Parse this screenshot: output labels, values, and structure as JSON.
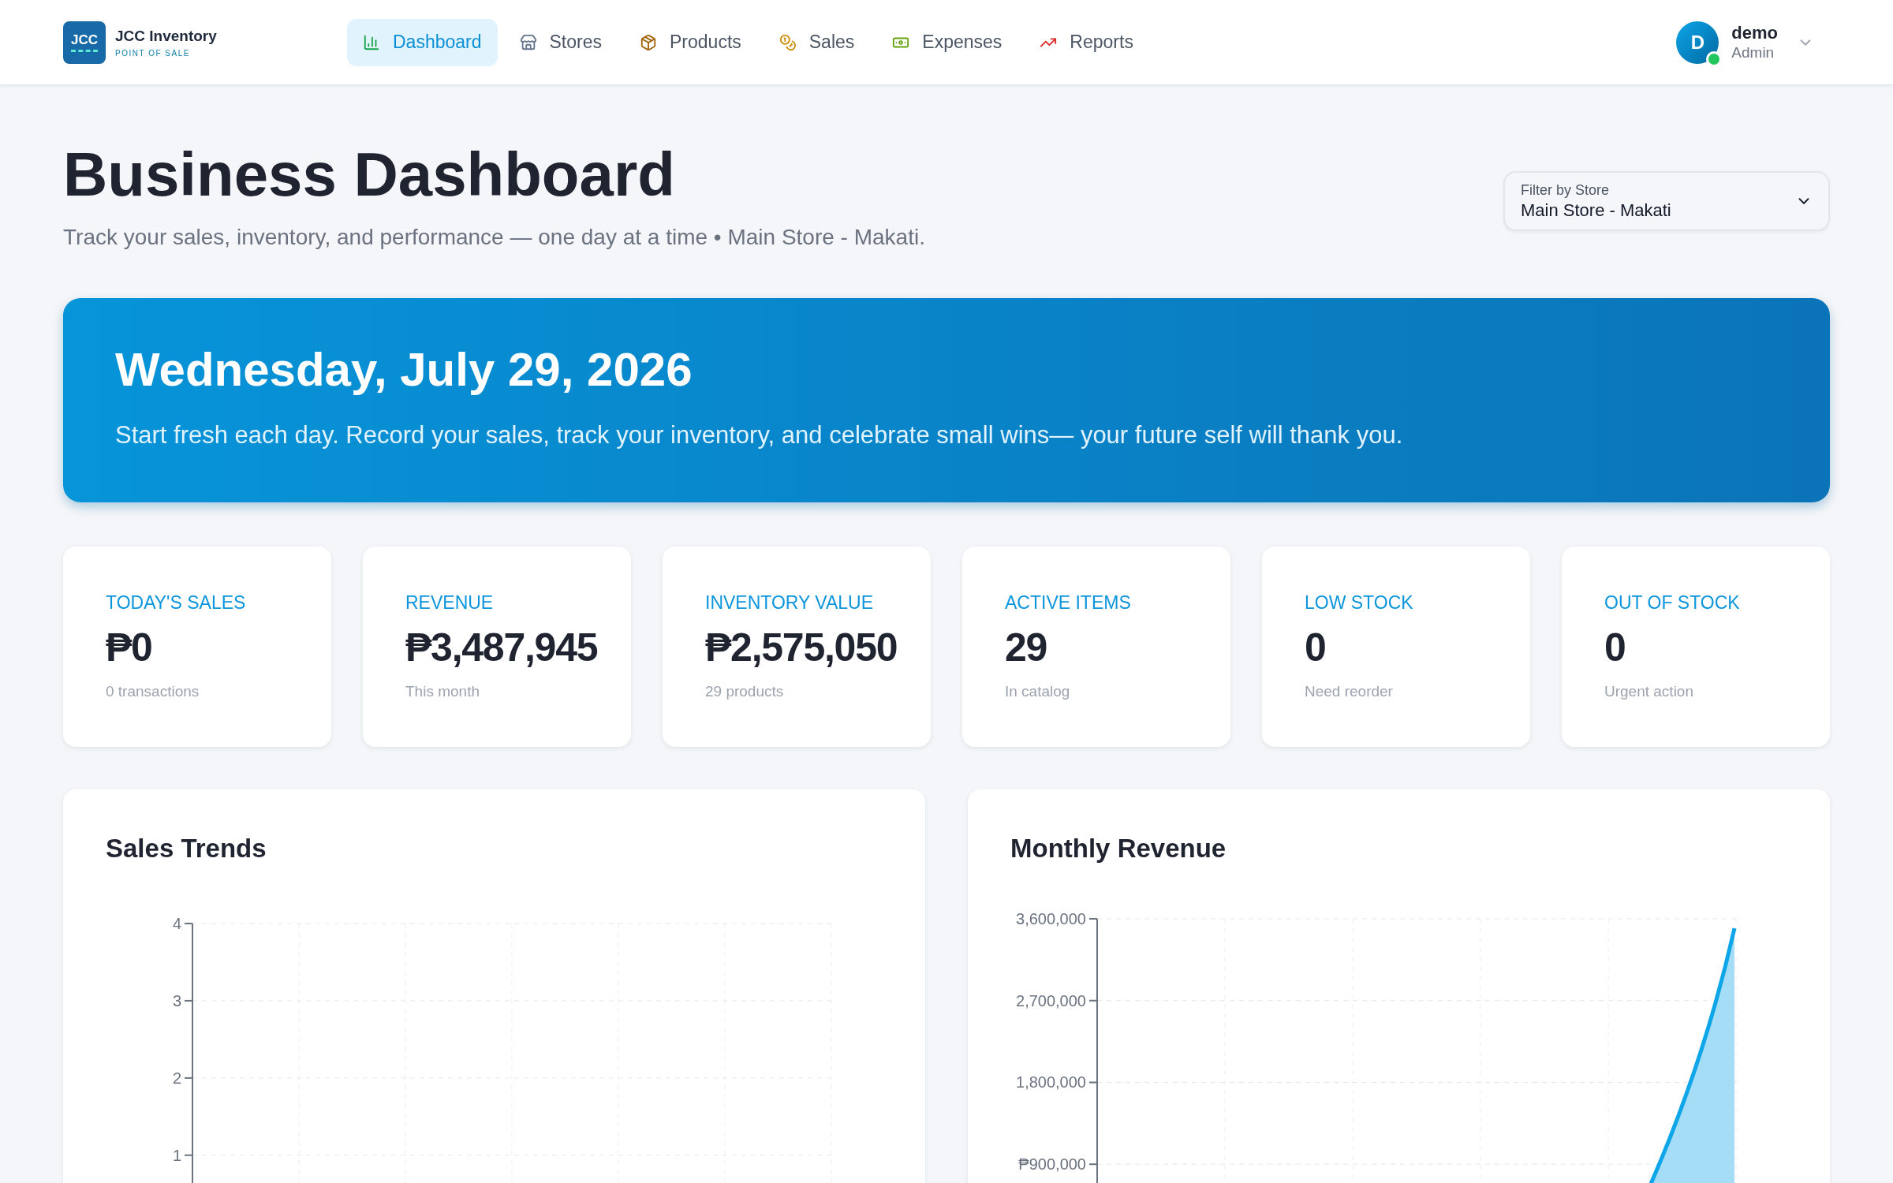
{
  "brand": {
    "logo": "JCC",
    "name": "JCC Inventory",
    "tagline": "POINT OF SALE"
  },
  "nav": [
    {
      "label": "Dashboard",
      "kind": "chart",
      "selected": true
    },
    {
      "label": "Stores",
      "kind": "store",
      "selected": false
    },
    {
      "label": "Products",
      "kind": "package",
      "selected": false
    },
    {
      "label": "Sales",
      "kind": "coins",
      "selected": false
    },
    {
      "label": "Expenses",
      "kind": "money",
      "selected": false
    },
    {
      "label": "Reports",
      "kind": "trend",
      "selected": false
    }
  ],
  "user": {
    "initial": "D",
    "name": "demo",
    "role": "Admin",
    "online": true
  },
  "page": {
    "title": "Business Dashboard",
    "subtitle": "Track your sales, inventory, and performance — one day at a time • Main Store - Makati."
  },
  "store_filter": {
    "label": "Filter by Store",
    "value": "Main Store - Makati"
  },
  "banner": {
    "date": "Wednesday, July 29, 2026",
    "message": "Start fresh each day. Record your sales, track your inventory, and celebrate small wins— your future self will thank you."
  },
  "stats": [
    {
      "label": "TODAY'S SALES",
      "value": "₱0",
      "note": "0 transactions"
    },
    {
      "label": "REVENUE",
      "value": "₱3,487,945",
      "note": "This month"
    },
    {
      "label": "INVENTORY VALUE",
      "value": "₱2,575,050",
      "note": "29 products"
    },
    {
      "label": "ACTIVE ITEMS",
      "value": "29",
      "note": "In catalog"
    },
    {
      "label": "LOW STOCK",
      "value": "0",
      "note": "Need reorder"
    },
    {
      "label": "OUT OF STOCK",
      "value": "0",
      "note": "Urgent action"
    }
  ],
  "charts": [
    {
      "title": "Sales Trends",
      "chart_data": {
        "type": "line",
        "grid": true,
        "ylim": [
          0.63,
          4
        ],
        "categories": [
          null,
          null,
          null,
          null,
          null,
          null,
          null
        ],
        "yticks": [
          {
            "value": 1,
            "label": "1"
          },
          {
            "value": 2,
            "label": "2"
          },
          {
            "value": 3,
            "label": "3"
          },
          {
            "value": 4,
            "label": "4"
          }
        ]
      }
    },
    {
      "title": "Monthly Revenue",
      "chart_data": {
        "type": "area",
        "grid": true,
        "categories": [
          null,
          null,
          null,
          null,
          null,
          null
        ],
        "ylim": [
          685000,
          3600000
        ],
        "yticks": [
          {
            "value": 900000,
            "label": "₱900,000"
          },
          {
            "value": 1800000,
            "label": "1,800,000"
          },
          {
            "value": 2700000,
            "label": "2,700,000"
          },
          {
            "value": 3600000,
            "label": "3,600,000"
          }
        ]
      }
    }
  ]
}
